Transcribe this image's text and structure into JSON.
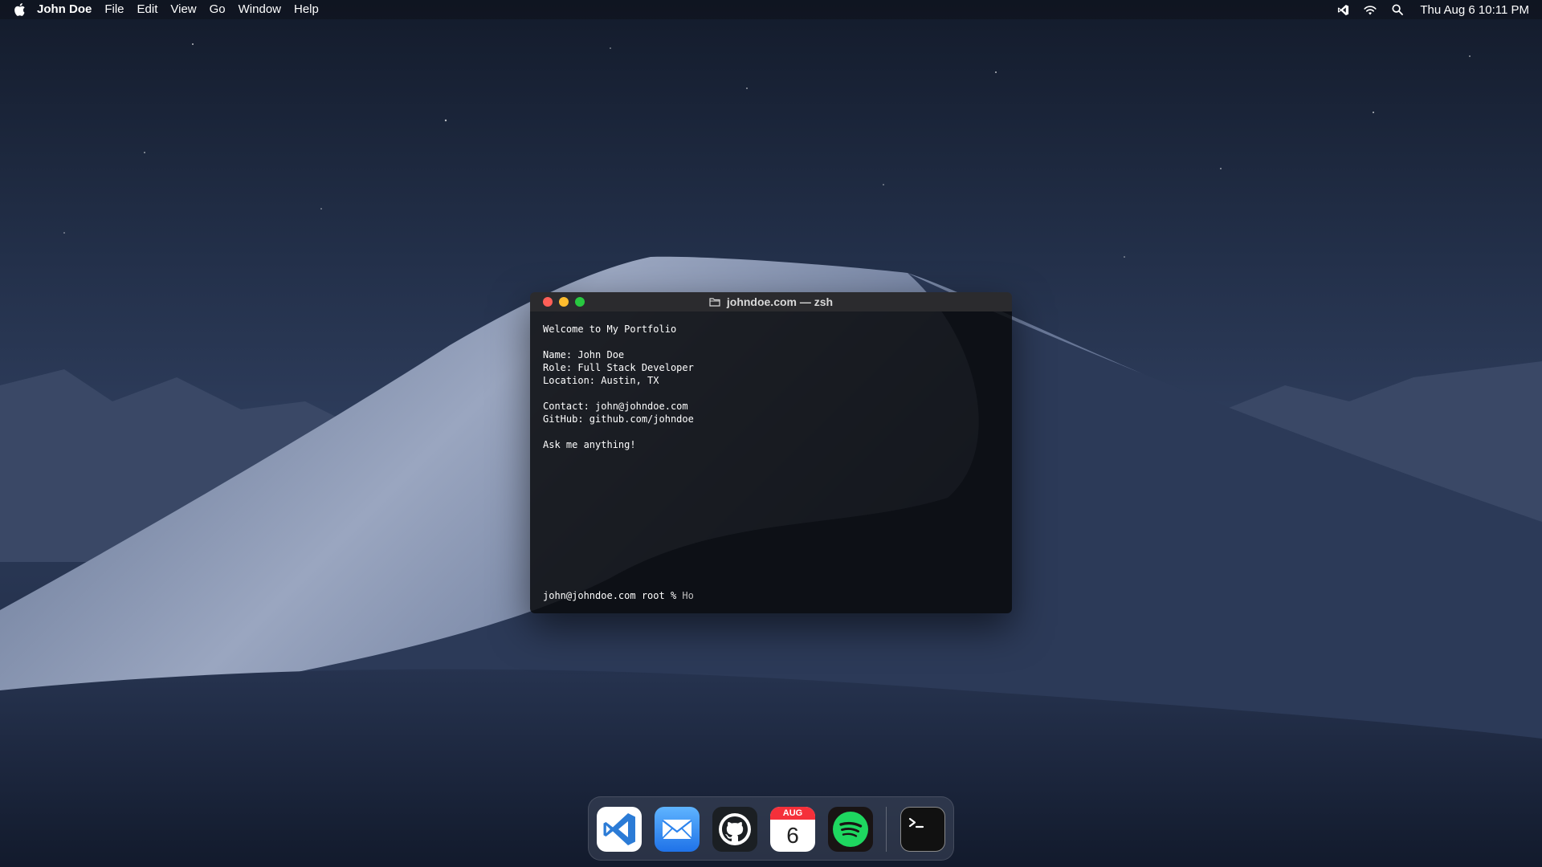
{
  "menubar": {
    "app_name": "John Doe",
    "menus": [
      "File",
      "Edit",
      "View",
      "Go",
      "Window",
      "Help"
    ],
    "clock": "Thu Aug 6 10:11 PM",
    "status_icons": [
      "vscode-icon",
      "wifi-icon",
      "search-icon"
    ]
  },
  "terminal": {
    "title": "johndoe.com — zsh",
    "lines": [
      "Welcome to My Portfolio",
      "",
      "Name: John Doe",
      "Role: Full Stack Developer",
      "Location: Austin, TX",
      "",
      "Contact: john@johndoe.com",
      "GitHub: github.com/johndoe",
      "",
      "Ask me anything!"
    ],
    "prompt": "john@johndoe.com root % ",
    "input": "Ho"
  },
  "dock": {
    "apps": [
      "vscode-icon",
      "mail-icon",
      "github-icon",
      "calendar-icon",
      "spotify-icon",
      "terminal-icon"
    ],
    "calendar_month": "AUG",
    "calendar_day": "6"
  },
  "colors": {
    "close": "#ff5f57",
    "minimize": "#febc2e",
    "maximize": "#28c840",
    "vscode_blue": "#2b7bd6",
    "spotify_green": "#1ed760",
    "calendar_red": "#f5303a"
  }
}
